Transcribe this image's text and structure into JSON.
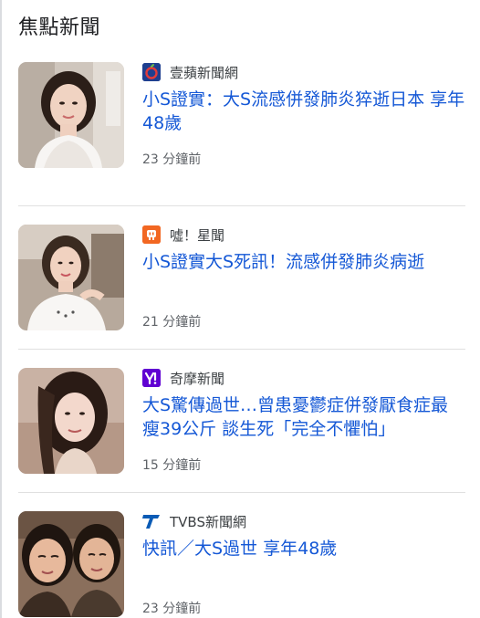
{
  "section": {
    "title": "焦點新聞"
  },
  "articles": [
    {
      "source": "壹蘋新聞網",
      "source_icon": "nextapple-logo-icon",
      "source_color": "#1f3f8f",
      "headline": "小S證實：大S流感併發肺炎猝逝日本 享年48歲",
      "time": "23 分鐘前",
      "thumbnail": "woman-portrait-photo"
    },
    {
      "source": "噓！星聞",
      "source_icon": "star-news-logo-icon",
      "source_color": "#f26722",
      "headline": "小S證實大S死訊！流感併發肺炎病逝",
      "time": "21 分鐘前",
      "thumbnail": "woman-portrait-photo"
    },
    {
      "source": "奇摩新聞",
      "source_icon": "yahoo-logo-icon",
      "source_color": "#6001d2",
      "headline": "大S驚傳過世…曾患憂鬱症併發厭食症最瘦39公斤 談生死「完全不懼怕」",
      "time": "15 分鐘前",
      "thumbnail": "woman-portrait-photo"
    },
    {
      "source": "TVBS新聞網",
      "source_icon": "tvbs-logo-icon",
      "source_color": "#0a5bb5",
      "headline": "快訊／大S過世 享年48歲",
      "time": "23 分鐘前",
      "thumbnail": "couple-selfie-photo"
    }
  ]
}
